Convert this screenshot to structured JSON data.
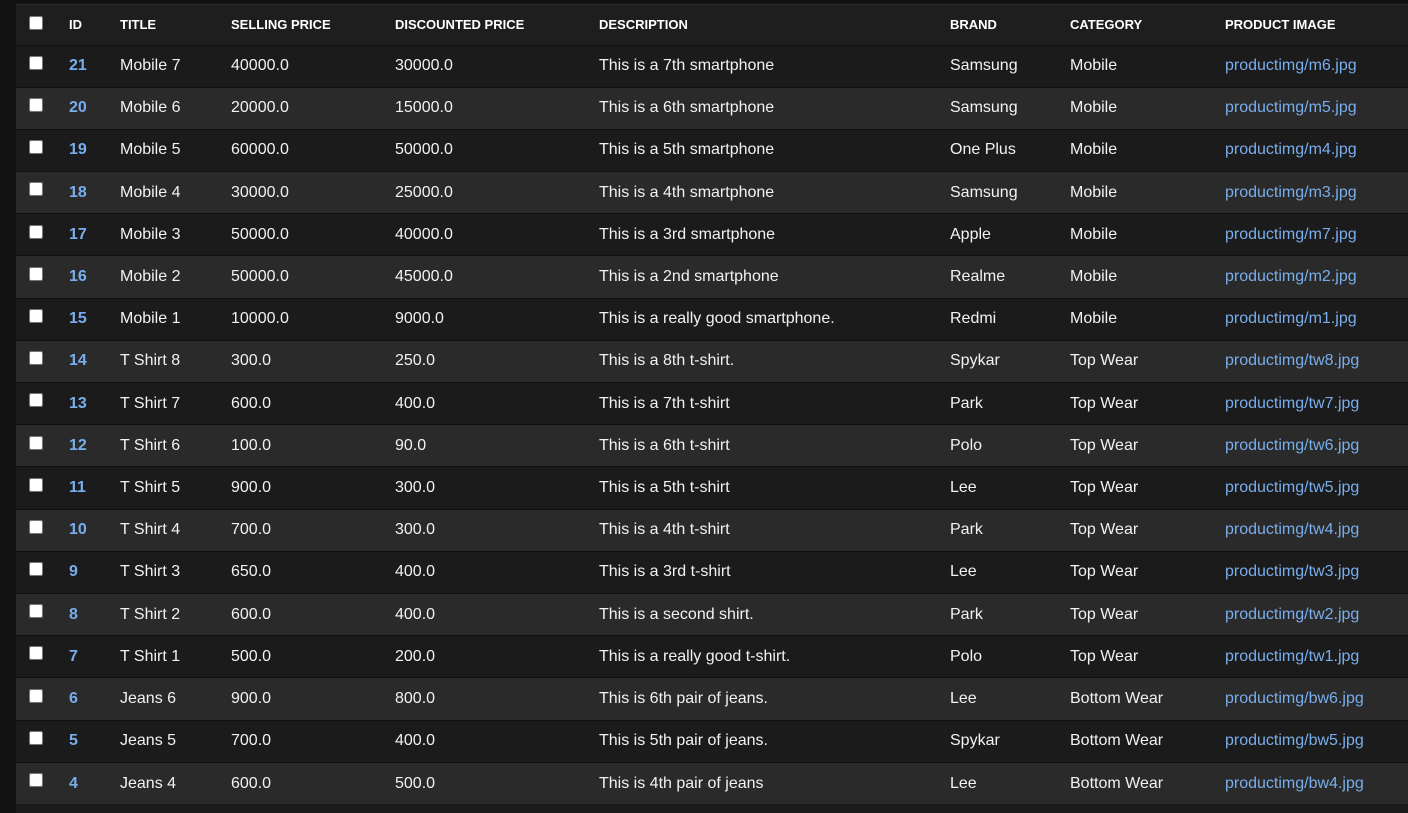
{
  "table": {
    "headers": {
      "id": "ID",
      "title": "TITLE",
      "selling_price": "SELLING PRICE",
      "discounted_price": "DISCOUNTED PRICE",
      "description": "DESCRIPTION",
      "brand": "BRAND",
      "category": "CATEGORY",
      "product_image": "PRODUCT IMAGE"
    },
    "rows": [
      {
        "id": "21",
        "title": "Mobile 7",
        "selling_price": "40000.0",
        "discounted_price": "30000.0",
        "description": "This is a 7th smartphone",
        "brand": "Samsung",
        "category": "Mobile",
        "product_image": "productimg/m6.jpg"
      },
      {
        "id": "20",
        "title": "Mobile 6",
        "selling_price": "20000.0",
        "discounted_price": "15000.0",
        "description": "This is a 6th smartphone",
        "brand": "Samsung",
        "category": "Mobile",
        "product_image": "productimg/m5.jpg"
      },
      {
        "id": "19",
        "title": "Mobile 5",
        "selling_price": "60000.0",
        "discounted_price": "50000.0",
        "description": "This is a 5th smartphone",
        "brand": "One Plus",
        "category": "Mobile",
        "product_image": "productimg/m4.jpg"
      },
      {
        "id": "18",
        "title": "Mobile 4",
        "selling_price": "30000.0",
        "discounted_price": "25000.0",
        "description": "This is a 4th smartphone",
        "brand": "Samsung",
        "category": "Mobile",
        "product_image": "productimg/m3.jpg"
      },
      {
        "id": "17",
        "title": "Mobile 3",
        "selling_price": "50000.0",
        "discounted_price": "40000.0",
        "description": "This is a 3rd smartphone",
        "brand": "Apple",
        "category": "Mobile",
        "product_image": "productimg/m7.jpg"
      },
      {
        "id": "16",
        "title": "Mobile 2",
        "selling_price": "50000.0",
        "discounted_price": "45000.0",
        "description": "This is a 2nd smartphone",
        "brand": "Realme",
        "category": "Mobile",
        "product_image": "productimg/m2.jpg"
      },
      {
        "id": "15",
        "title": "Mobile 1",
        "selling_price": "10000.0",
        "discounted_price": "9000.0",
        "description": "This is a really good smartphone.",
        "brand": "Redmi",
        "category": "Mobile",
        "product_image": "productimg/m1.jpg"
      },
      {
        "id": "14",
        "title": "T Shirt 8",
        "selling_price": "300.0",
        "discounted_price": "250.0",
        "description": "This is a 8th t-shirt.",
        "brand": "Spykar",
        "category": "Top Wear",
        "product_image": "productimg/tw8.jpg"
      },
      {
        "id": "13",
        "title": "T Shirt 7",
        "selling_price": "600.0",
        "discounted_price": "400.0",
        "description": "This is a 7th t-shirt",
        "brand": "Park",
        "category": "Top Wear",
        "product_image": "productimg/tw7.jpg"
      },
      {
        "id": "12",
        "title": "T Shirt 6",
        "selling_price": "100.0",
        "discounted_price": "90.0",
        "description": "This is a 6th t-shirt",
        "brand": "Polo",
        "category": "Top Wear",
        "product_image": "productimg/tw6.jpg"
      },
      {
        "id": "11",
        "title": "T Shirt 5",
        "selling_price": "900.0",
        "discounted_price": "300.0",
        "description": "This is a 5th t-shirt",
        "brand": "Lee",
        "category": "Top Wear",
        "product_image": "productimg/tw5.jpg"
      },
      {
        "id": "10",
        "title": "T Shirt 4",
        "selling_price": "700.0",
        "discounted_price": "300.0",
        "description": "This is a 4th t-shirt",
        "brand": "Park",
        "category": "Top Wear",
        "product_image": "productimg/tw4.jpg"
      },
      {
        "id": "9",
        "title": "T Shirt 3",
        "selling_price": "650.0",
        "discounted_price": "400.0",
        "description": "This is a 3rd t-shirt",
        "brand": "Lee",
        "category": "Top Wear",
        "product_image": "productimg/tw3.jpg"
      },
      {
        "id": "8",
        "title": "T Shirt 2",
        "selling_price": "600.0",
        "discounted_price": "400.0",
        "description": "This is a second shirt.",
        "brand": "Park",
        "category": "Top Wear",
        "product_image": "productimg/tw2.jpg"
      },
      {
        "id": "7",
        "title": "T Shirt 1",
        "selling_price": "500.0",
        "discounted_price": "200.0",
        "description": "This is a really good t-shirt.",
        "brand": "Polo",
        "category": "Top Wear",
        "product_image": "productimg/tw1.jpg"
      },
      {
        "id": "6",
        "title": "Jeans 6",
        "selling_price": "900.0",
        "discounted_price": "800.0",
        "description": "This is 6th pair of jeans.",
        "brand": "Lee",
        "category": "Bottom Wear",
        "product_image": "productimg/bw6.jpg"
      },
      {
        "id": "5",
        "title": "Jeans 5",
        "selling_price": "700.0",
        "discounted_price": "400.0",
        "description": "This is 5th pair of jeans.",
        "brand": "Spykar",
        "category": "Bottom Wear",
        "product_image": "productimg/bw5.jpg"
      },
      {
        "id": "4",
        "title": "Jeans 4",
        "selling_price": "600.0",
        "discounted_price": "500.0",
        "description": "This is 4th pair of jeans",
        "brand": "Lee",
        "category": "Bottom Wear",
        "product_image": "productimg/bw4.jpg"
      }
    ]
  },
  "colors": {
    "background": "#1b1b1b",
    "alt_row": "#2a2a2a",
    "link": "#79aeec",
    "text": "#f2f2f2"
  }
}
